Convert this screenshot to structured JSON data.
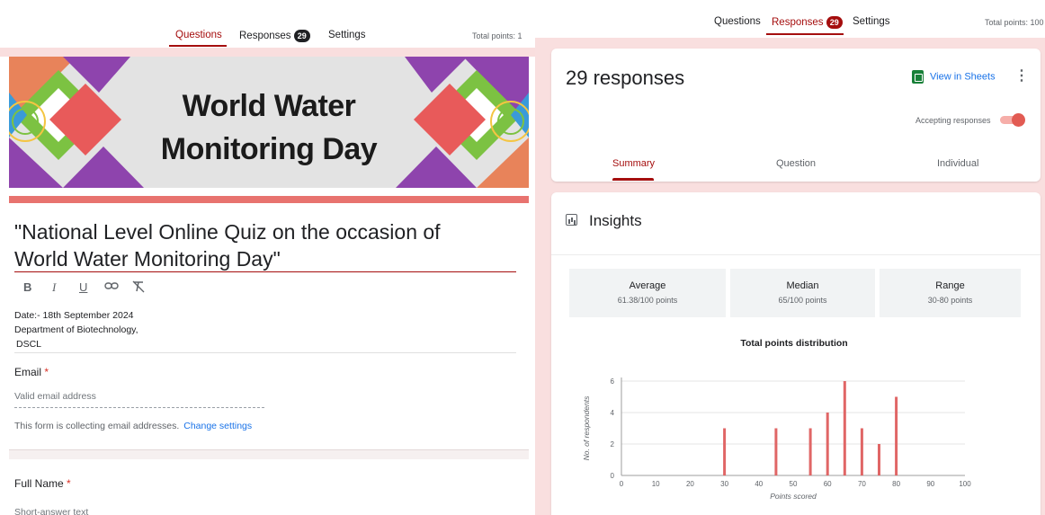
{
  "left": {
    "tabs": {
      "questions": "Questions",
      "responses": "Responses",
      "responses_count": "29",
      "settings": "Settings"
    },
    "total_points": "Total points: 1",
    "banner": {
      "line1": "World Water",
      "line2": "Monitoring Day",
      "colors": [
        "#8e44ad",
        "#e85a5a",
        "#7cc242",
        "#3a9ad9",
        "#f39c12"
      ]
    },
    "form_title_line1": "\"National Level Online Quiz on the occasion of",
    "form_title_line2": "World Water Monitoring Day\"",
    "format_toolbar": [
      "B",
      "I",
      "U",
      "link-icon",
      "clear-format-icon"
    ],
    "description": {
      "line1": "Date:- 18th September 2024",
      "line2": "Department of Biotechnology,",
      "line3": "DSCL"
    },
    "email": {
      "label": "Email",
      "required_mark": "*",
      "placeholder": "Valid email address",
      "collecting_text": "This form is collecting email addresses.",
      "change_link": "Change settings"
    },
    "full_name": {
      "label": "Full Name",
      "required_mark": "*",
      "placeholder": "Short-answer text"
    }
  },
  "right": {
    "tabs": {
      "questions": "Questions",
      "responses": "Responses",
      "responses_count": "29",
      "settings": "Settings"
    },
    "total_points": "Total points: 100",
    "responses_title": "29 responses",
    "view_in_sheets": "View in Sheets",
    "accepting": "Accepting responses",
    "accepting_on": true,
    "subtabs": [
      "Summary",
      "Question",
      "Individual"
    ],
    "insights_title": "Insights",
    "stats": [
      {
        "label": "Average",
        "value": "61.38/100 points"
      },
      {
        "label": "Median",
        "value": "65/100 points"
      },
      {
        "label": "Range",
        "value": "30-80 points"
      }
    ]
  },
  "chart_data": {
    "type": "bar",
    "title": "Total points distribution",
    "xlabel": "Points scored",
    "ylabel": "No. of respondents",
    "x": [
      30,
      45,
      55,
      60,
      65,
      70,
      75,
      80
    ],
    "values": [
      3,
      3,
      3,
      4,
      6,
      3,
      2,
      5
    ],
    "xlim": [
      0,
      100
    ],
    "ylim": [
      0,
      6
    ],
    "xticks": [
      0,
      10,
      20,
      30,
      40,
      50,
      60,
      70,
      80,
      90,
      100
    ],
    "yticks": [
      0,
      2,
      4,
      6
    ],
    "bar_color": "#e06666",
    "grid": true
  }
}
